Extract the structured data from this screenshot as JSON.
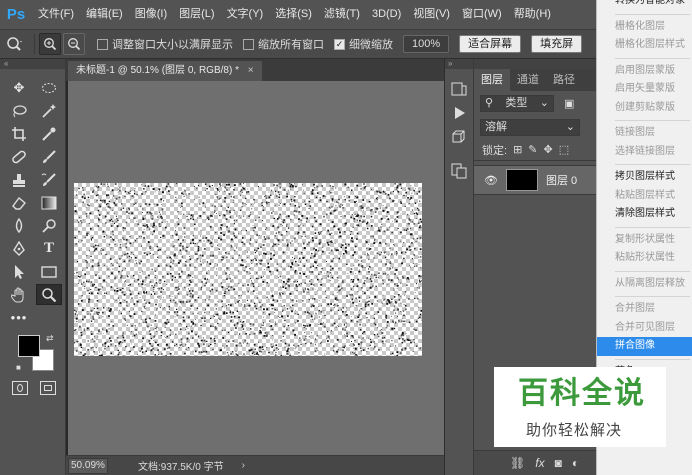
{
  "app": {
    "logo": "Ps"
  },
  "menu": [
    "文件(F)",
    "编辑(E)",
    "图像(I)",
    "图层(L)",
    "文字(Y)",
    "选择(S)",
    "滤镜(T)",
    "3D(D)",
    "视图(V)",
    "窗口(W)",
    "帮助(H)"
  ],
  "options": {
    "resize_window_label": "调整窗口大小以满屏显示",
    "resize_window_checked": false,
    "zoom_all_label": "缩放所有窗口",
    "zoom_all_checked": false,
    "scrubby_zoom_label": "细微缩放",
    "scrubby_zoom_checked": true,
    "btn_100": "100%",
    "btn_fit": "适合屏幕",
    "btn_fill": "填充屏"
  },
  "document": {
    "tab_title": "未标题-1 @ 50.1% (图层 0, RGB/8) *",
    "tab_close": "×",
    "zoom": "50.09%",
    "doc_info": "文档:937.5K/0 字节",
    "status_arrow": "›"
  },
  "layers_panel": {
    "tabs": [
      "图层",
      "通道",
      "路径"
    ],
    "filter_label": "类型",
    "blend_mode": "溶解",
    "lock_label": "锁定:",
    "layers": [
      {
        "name": "图层 0",
        "visible": true
      }
    ],
    "footer_icons": [
      "link-icon",
      "fx-icon",
      "mask-icon",
      "adjustment-icon"
    ]
  },
  "context_menu": {
    "items": [
      {
        "label": "转换为智能对象",
        "enabled": true
      },
      {
        "sep": true
      },
      {
        "label": "栅格化图层",
        "enabled": false
      },
      {
        "label": "栅格化图层样式",
        "enabled": false
      },
      {
        "sep": true
      },
      {
        "label": "启用图层蒙版",
        "enabled": false
      },
      {
        "label": "启用矢量蒙版",
        "enabled": false
      },
      {
        "label": "创建剪贴蒙版",
        "enabled": false
      },
      {
        "sep": true
      },
      {
        "label": "链接图层",
        "enabled": false
      },
      {
        "label": "选择链接图层",
        "enabled": false
      },
      {
        "sep": true
      },
      {
        "label": "拷贝图层样式",
        "enabled": true
      },
      {
        "label": "粘贴图层样式",
        "enabled": false
      },
      {
        "label": "清除图层样式",
        "enabled": true
      },
      {
        "sep": true
      },
      {
        "label": "复制形状属性",
        "enabled": false
      },
      {
        "label": "粘贴形状属性",
        "enabled": false
      },
      {
        "sep": true
      },
      {
        "label": "从隔离图层释放",
        "enabled": false
      },
      {
        "sep": true
      },
      {
        "label": "合并图层",
        "enabled": false
      },
      {
        "label": "合并可见图层",
        "enabled": false
      },
      {
        "label": "拼合图像",
        "enabled": true,
        "highlighted": true
      },
      {
        "sep": true
      },
      {
        "label": "蓝色",
        "enabled": true
      }
    ]
  },
  "watermark": {
    "title": "百科全说",
    "subtitle": "助你轻松解决"
  },
  "colors": {
    "accent": "#31a8ff",
    "highlight": "#2d8ceb",
    "watermark_green": "#3c9a3c"
  }
}
